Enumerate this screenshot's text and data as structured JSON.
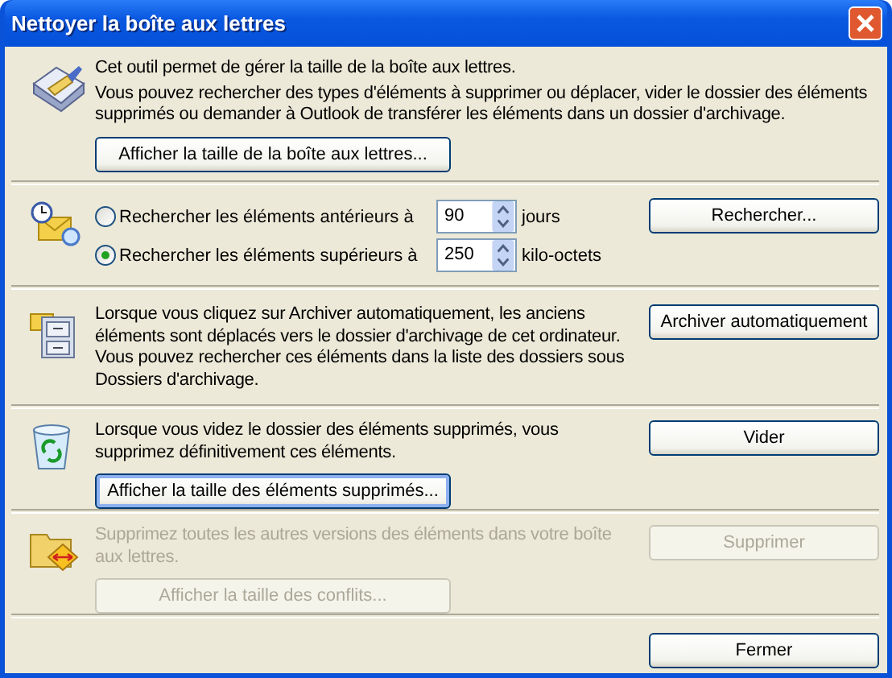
{
  "window": {
    "title": "Nettoyer la boîte aux lettres"
  },
  "mailbox_size": {
    "paragraphs": [
      "Cet outil permet de gérer la taille de la boîte aux lettres.",
      "Vous pouvez rechercher des types d'éléments à supprimer ou déplacer, vider le dossier des éléments supprimés ou demander à Outlook de transférer les éléments dans un dossier d'archivage."
    ],
    "button": {
      "label": "Afficher la taille de la boîte aux lettres...",
      "disabled": false,
      "default": false
    }
  },
  "find": {
    "options": [
      {
        "label": "Rechercher les éléments antérieurs à",
        "selected": false,
        "value": "90",
        "unit": "jours"
      },
      {
        "label": "Rechercher les éléments supérieurs à",
        "selected": true,
        "value": "250",
        "unit": "kilo-octets"
      }
    ],
    "button": {
      "label": "Rechercher...",
      "disabled": false,
      "default": false
    }
  },
  "autoarchive": {
    "text": "Lorsque vous cliquez sur Archiver automatiquement, les anciens éléments sont déplacés vers le dossier d'archivage de cet ordinateur. Vous pouvez rechercher ces éléments dans la liste des dossiers sous Dossiers d'archivage.",
    "button": {
      "label": "Archiver automatiquement",
      "disabled": false,
      "default": false
    }
  },
  "deleted_items": {
    "text": "Lorsque vous videz le dossier des éléments supprimés, vous supprimez définitivement ces éléments.",
    "disabled": false,
    "size_button": {
      "label": "Afficher la taille des éléments supprimés...",
      "disabled": false,
      "default": true
    },
    "button": {
      "label": "Vider",
      "disabled": false,
      "default": false
    }
  },
  "conflicts": {
    "text": "Supprimez toutes les autres versions des éléments dans votre boîte aux lettres.",
    "disabled": true,
    "size_button": {
      "label": "Afficher la taille des conflits...",
      "disabled": true,
      "default": false
    },
    "button": {
      "label": "Supprimer",
      "disabled": true,
      "default": false
    }
  },
  "close_button": {
    "label": "Fermer",
    "disabled": false,
    "default": false
  }
}
